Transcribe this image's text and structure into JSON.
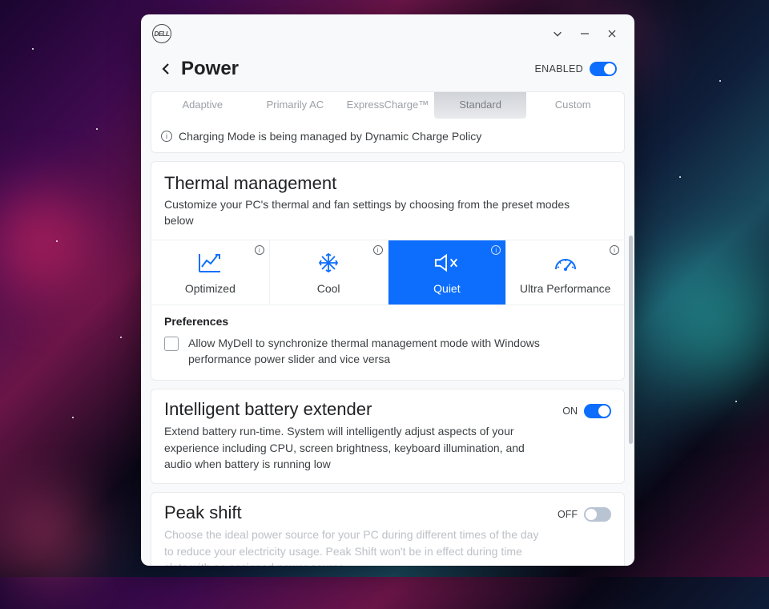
{
  "titlebar": {
    "brand": "DELL"
  },
  "header": {
    "title": "Power",
    "enabled_label": "ENABLED",
    "enabled": true
  },
  "charging": {
    "modes": [
      "Adaptive",
      "Primarily AC",
      "ExpressCharge™",
      "Standard",
      "Custom"
    ],
    "selected_index": 3,
    "notice": "Charging Mode is being managed by Dynamic Charge Policy"
  },
  "thermal": {
    "title": "Thermal management",
    "desc": "Customize your PC's thermal and fan settings by choosing from the preset modes below",
    "tiles": [
      {
        "label": "Optimized",
        "icon": "chart"
      },
      {
        "label": "Cool",
        "icon": "snowflake"
      },
      {
        "label": "Quiet",
        "icon": "mute"
      },
      {
        "label": "Ultra Performance",
        "icon": "gauge"
      }
    ],
    "selected_index": 2,
    "pref_title": "Preferences",
    "pref_checkbox": "Allow MyDell to synchronize thermal management mode with Windows performance power slider and vice versa",
    "pref_checked": false
  },
  "battery_extender": {
    "title": "Intelligent battery extender",
    "desc": "Extend battery run-time. System will intelligently adjust aspects of your experience including CPU, screen brightness, keyboard illumination, and audio when battery is running low",
    "state_label": "ON",
    "state": true
  },
  "peak_shift": {
    "title": "Peak shift",
    "desc": "Choose the ideal power source for your PC during different times of the day to reduce your electricity usage. Peak Shift won't be in effect during time slots with no assigned power source.",
    "state_label": "OFF",
    "state": false
  },
  "colors": {
    "accent": "#0d6efd"
  }
}
